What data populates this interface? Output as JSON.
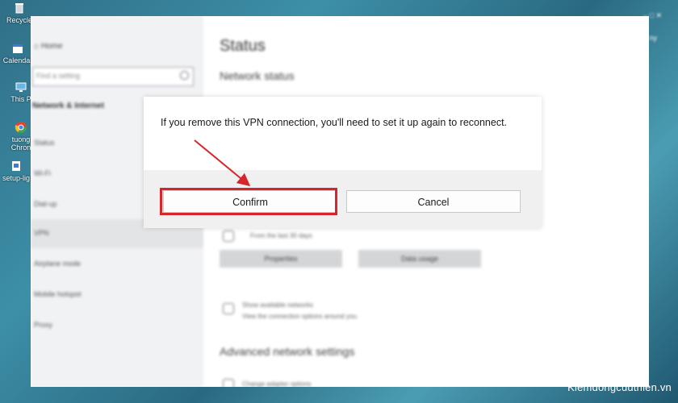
{
  "desktop": {
    "icons": [
      {
        "label": "Recycle",
        "icon": "recycle-bin-icon"
      },
      {
        "label": "Calendar",
        "icon": "calendar-icon"
      },
      {
        "label": "This P",
        "icon": "this-pc-icon"
      },
      {
        "label": "tuong\nChron",
        "icon": "chrome-icon"
      },
      {
        "label": "setup-lig",
        "icon": "setup-file-icon"
      }
    ],
    "tray_hint": "ny"
  },
  "settings": {
    "sidebar": {
      "home": "Home",
      "search_placeholder": "Find a setting",
      "section": "Network & Internet",
      "items": [
        {
          "label": "Status"
        },
        {
          "label": "Wi-Fi"
        },
        {
          "label": "Dial-up"
        },
        {
          "label": "VPN"
        },
        {
          "label": "Airplane mode"
        },
        {
          "label": "Mobile hotspot"
        },
        {
          "label": "Proxy"
        }
      ]
    },
    "content": {
      "title": "Status",
      "subtitle": "Network status",
      "data_usage_note": "From the last 30 days",
      "properties_button": "Properties",
      "data_usage_button": "Data usage",
      "show_networks": "Show available networks",
      "show_networks_desc": "View the connection options around you.",
      "advanced_title": "Advanced network settings",
      "change_adapter": "Change adapter options"
    }
  },
  "dialog": {
    "message": "If you remove this VPN connection, you'll need to set it up again to reconnect.",
    "confirm_label": "Confirm",
    "cancel_label": "Cancel"
  },
  "annotation": {
    "highlight_color": "#d7262b"
  },
  "watermark": "Kiemdongcuuthien.vn"
}
